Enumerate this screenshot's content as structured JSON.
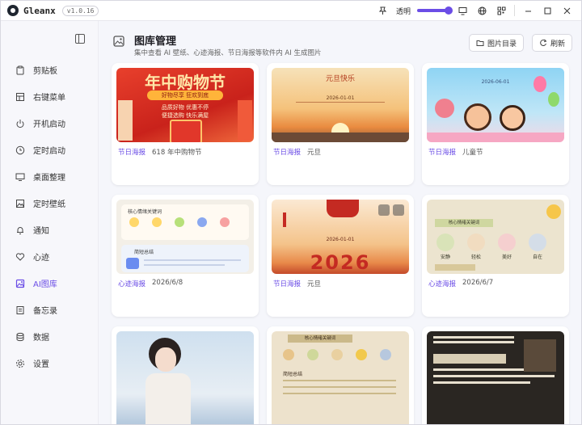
{
  "titlebar": {
    "app_name": "Gleanx",
    "version": "v1.0.16",
    "opacity_label": "透明",
    "opacity_level": 0.85,
    "icons": [
      "pin-icon",
      "monitor-icon",
      "globe-icon",
      "qr-icon",
      "minimize-icon",
      "maximize-icon",
      "close-icon"
    ]
  },
  "sidebar": {
    "items": [
      {
        "label": "剪贴板",
        "icon": "clipboard-icon",
        "active": false
      },
      {
        "label": "右键菜单",
        "icon": "grid-icon",
        "active": false
      },
      {
        "label": "开机启动",
        "icon": "power-icon",
        "active": false
      },
      {
        "label": "定时启动",
        "icon": "clock-icon",
        "active": false
      },
      {
        "label": "桌面整理",
        "icon": "desktop-icon",
        "active": false
      },
      {
        "label": "定时壁纸",
        "icon": "image-icon",
        "active": false
      },
      {
        "label": "通知",
        "icon": "bell-icon",
        "active": false
      },
      {
        "label": "心迹",
        "icon": "heart-icon",
        "active": false
      },
      {
        "label": "AI图库",
        "icon": "gallery-icon",
        "active": true
      },
      {
        "label": "备忘录",
        "icon": "memo-icon",
        "active": false
      },
      {
        "label": "数据",
        "icon": "database-icon",
        "active": false
      },
      {
        "label": "设置",
        "icon": "gear-icon",
        "active": false
      }
    ]
  },
  "header": {
    "title": "图库管理",
    "subtitle": "集中查看 AI 壁纸、心迹海报、节日海报等软件内 AI 生成图片",
    "folder_button": "图片目录",
    "refresh_button": "刷新"
  },
  "colors": {
    "accent": "#6b4de6"
  },
  "cards": [
    {
      "tag": "节日海报",
      "desc": "618 年中购物节",
      "thumb_heading": "年中购物节",
      "thumb_lines": [
        "好物尽享  狂欢到底",
        "品质好物  优惠不停",
        "便捷选购  快乐满屋"
      ]
    },
    {
      "tag": "节日海报",
      "desc": "元旦",
      "thumb_heading": "元旦快乐",
      "thumb_lines": [
        "2026-01-01"
      ]
    },
    {
      "tag": "节日海报",
      "desc": "儿童节",
      "thumb_heading": "",
      "thumb_lines": [
        "2026-06-01"
      ]
    },
    {
      "tag": "心迹海报",
      "desc": "2026/6/8",
      "thumb_heading": "核心情绪关键词",
      "thumb_lines": [
        "简短总结"
      ]
    },
    {
      "tag": "节日海报",
      "desc": "元旦",
      "thumb_heading": "2026",
      "thumb_lines": [
        "2026-01-01"
      ]
    },
    {
      "tag": "心迹海报",
      "desc": "2026/6/7",
      "thumb_heading": "核心情绪关键词",
      "thumb_lines": [
        "安静",
        "轻松",
        "美好",
        "自在"
      ]
    },
    {
      "tag": "",
      "desc": "",
      "thumb_heading": "",
      "thumb_lines": []
    },
    {
      "tag": "",
      "desc": "",
      "thumb_heading": "核心情绪关键词",
      "thumb_lines": [
        "简短总结"
      ]
    },
    {
      "tag": "",
      "desc": "",
      "thumb_heading": "",
      "thumb_lines": []
    }
  ]
}
